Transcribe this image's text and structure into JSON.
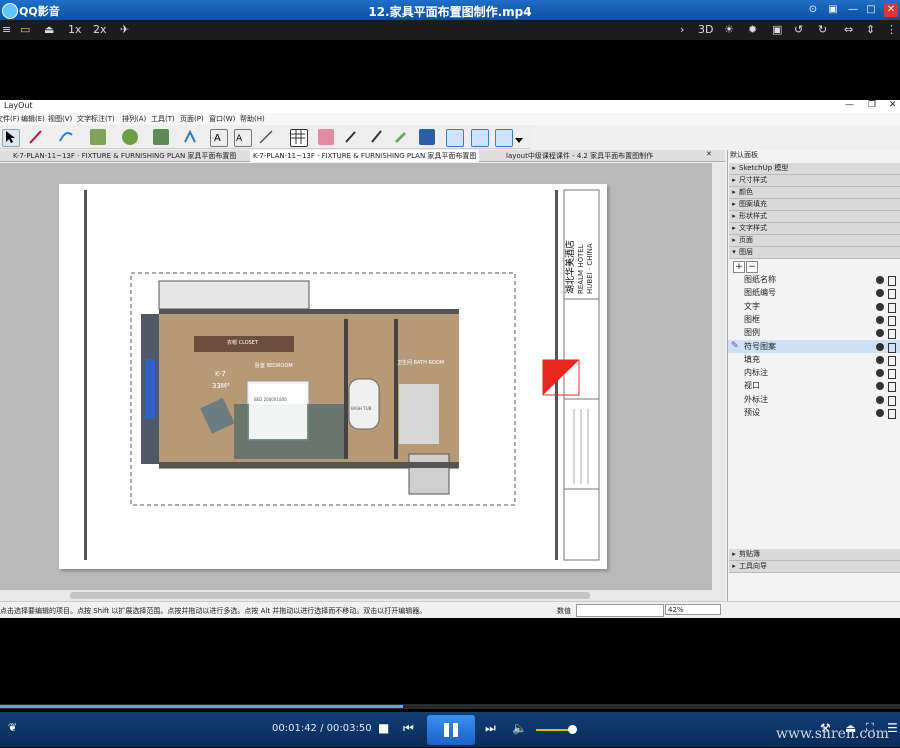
{
  "player": {
    "app_name": "QQ影音",
    "file_name": "12.家具平面布置图制作.mp4",
    "toolbar": {
      "speed1": "1x",
      "speed2": "2x",
      "mode3d": "3D"
    },
    "time_current": "00:01:42",
    "time_sep": " / ",
    "time_total": "00:03:50",
    "progress": 0.448,
    "watermark": "www.shren.com"
  },
  "layout": {
    "window_title": "LayOut",
    "menus": [
      "文件(F)",
      "编辑(E)",
      "视图(V)",
      "文字标注(T)",
      "排列(A)",
      "工具(T)",
      "页面(P)",
      "窗口(W)",
      "帮助(H)"
    ],
    "tabs": [
      "K-7-PLAN-11~13F · FIXTURE & FURNISHING PLAN 家具平面布置图",
      "K-7-PLAN-11~13F · FIXTURE & FURNISHING PLAN 家具平面布置图",
      "layout中级课程课件 - 4.2 家具平面布置图制作"
    ],
    "active_tab": 1,
    "status_message": "点击选择要编辑的项目。点按 Shift 以扩展选择范围。点按并拖动以进行多选。点按 Alt 并拖动以进行选择而不移动。双击以打开编辑器。",
    "measure_label": "数值",
    "zoom": "42%",
    "drawing": {
      "room_id": "K-7",
      "room_area": "33M²",
      "room_labels": [
        "卧室 BEDROOM",
        "衣帽 CLOSET",
        "卫生间 BATH ROOM",
        "BED 2000X1800",
        "BASH TUB"
      ],
      "title_block": {
        "brand_cn": "湖北华美酒店",
        "brand_en1": "REALM HOTEL",
        "brand_en2": "HUBEI · CHINA"
      }
    },
    "panel": {
      "title": "默认面板",
      "sections_top": [
        "SketchUp 模型",
        "尺寸样式",
        "颜色",
        "图案填充",
        "形状样式",
        "文字样式",
        "页面"
      ],
      "layers_section": "图层",
      "add_btn": "+",
      "remove_btn": "−",
      "layers": [
        "图纸名称",
        "图纸编号",
        "文字",
        "图框",
        "图例",
        "符号图案",
        "填充",
        "内标注",
        "视口",
        "外标注",
        "预设"
      ],
      "selected_layer": 5,
      "sections_bottom": [
        "剪贴簿",
        "工具向导"
      ]
    }
  }
}
